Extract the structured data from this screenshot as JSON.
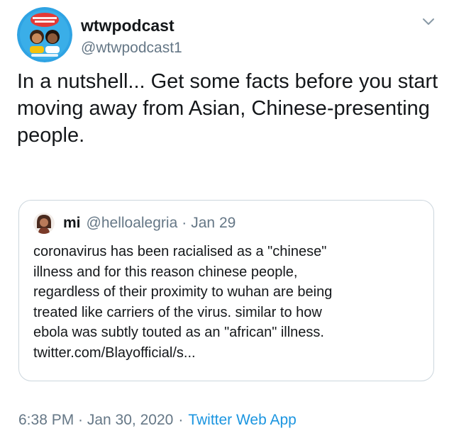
{
  "tweet": {
    "display_name": "wtwpodcast",
    "handle": "@wtwpodcast1",
    "text": "In a nutshell... Get some facts before you start moving away from Asian, Chinese-presenting people.",
    "timestamp": "6:38 PM · Jan 30, 2020",
    "separator": "·",
    "source": "Twitter Web App",
    "avatar_icon": "podcast-logo-icon",
    "caret_icon": "chevron-down-icon"
  },
  "quote": {
    "display_name": "mi",
    "handle": "@helloalegria",
    "separator": "·",
    "date": "Jan 29",
    "text_lines": [
      "coronavirus has been racialised as a \"chinese\"",
      "illness and for this reason chinese people,",
      "regardless of their proximity to wuhan are being",
      "treated like carriers of the virus. similar to how",
      "ebola was subtly touted as an \"african\" illness.",
      "twitter.com/Blayofficial/s..."
    ]
  },
  "colors": {
    "text_primary": "#14171a",
    "text_secondary": "#657786",
    "link": "#1b95e0",
    "border": "#ccd6dd"
  }
}
